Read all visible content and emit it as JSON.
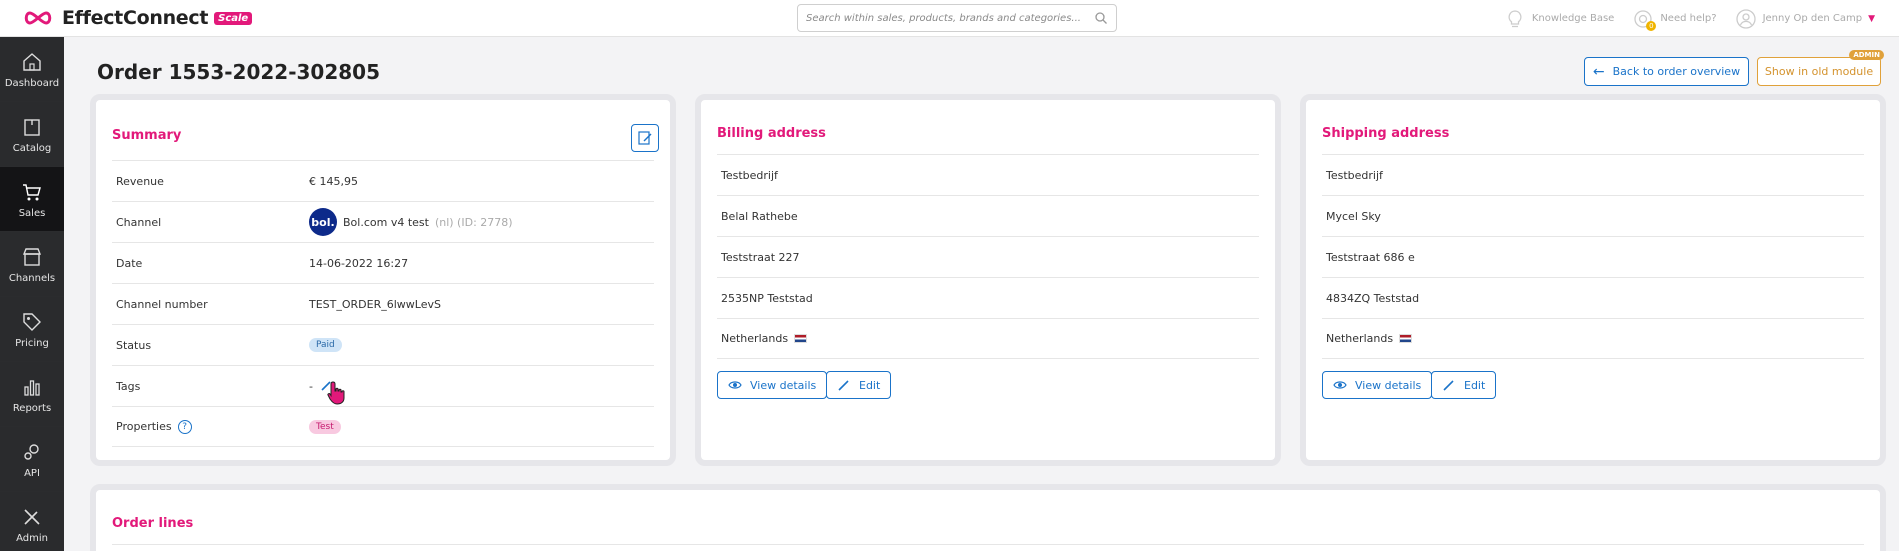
{
  "app": {
    "name": "EffectConnect",
    "badge": "Scale"
  },
  "search": {
    "placeholder": "Search within sales, products, brands and categories..."
  },
  "topbar": {
    "knowledge_base": "Knowledge Base",
    "need_help": "Need help?",
    "user": "Jenny Op den Camp",
    "help_badge": "0"
  },
  "sidebar": {
    "items": [
      {
        "label": "Dashboard"
      },
      {
        "label": "Catalog"
      },
      {
        "label": "Sales"
      },
      {
        "label": "Channels"
      },
      {
        "label": "Pricing"
      },
      {
        "label": "Reports"
      },
      {
        "label": "API"
      },
      {
        "label": "Admin"
      }
    ]
  },
  "page": {
    "title": "Order 1553-2022-302805",
    "back_label": "Back to order overview",
    "old_module_label": "Show in old module",
    "admin_badge": "ADMIN"
  },
  "summary": {
    "title": "Summary",
    "revenue_label": "Revenue",
    "revenue": "€ 145,95",
    "channel_label": "Channel",
    "channel_logo": "bol.",
    "channel_name": "Bol.com v4 test",
    "channel_meta": "(nl) (ID: 2778)",
    "date_label": "Date",
    "date": "14-06-2022 16:27",
    "channel_number_label": "Channel number",
    "channel_number": "TEST_ORDER_6lwwLevS",
    "status_label": "Status",
    "status": "Paid",
    "tags_label": "Tags",
    "tags": "-",
    "properties_label": "Properties",
    "properties_help": "?",
    "property": "Test"
  },
  "billing": {
    "title": "Billing address",
    "company": "Testbedrijf",
    "name": "Belal Rathebe",
    "street": "Teststraat 227",
    "city": "2535NP Teststad",
    "country": "Netherlands",
    "view_label": "View details",
    "edit_label": "Edit"
  },
  "shipping": {
    "title": "Shipping address",
    "company": "Testbedrijf",
    "name": "Mycel Sky",
    "street": "Teststraat 686 e",
    "city": "4834ZQ Teststad",
    "country": "Netherlands",
    "view_label": "View details",
    "edit_label": "Edit"
  },
  "order_lines": {
    "title": "Order lines"
  },
  "colors": {
    "accent_pink": "#e2197a",
    "accent_blue": "#1a73c9",
    "admin_orange": "#e0a13a",
    "sidebar": "#1f2022"
  }
}
